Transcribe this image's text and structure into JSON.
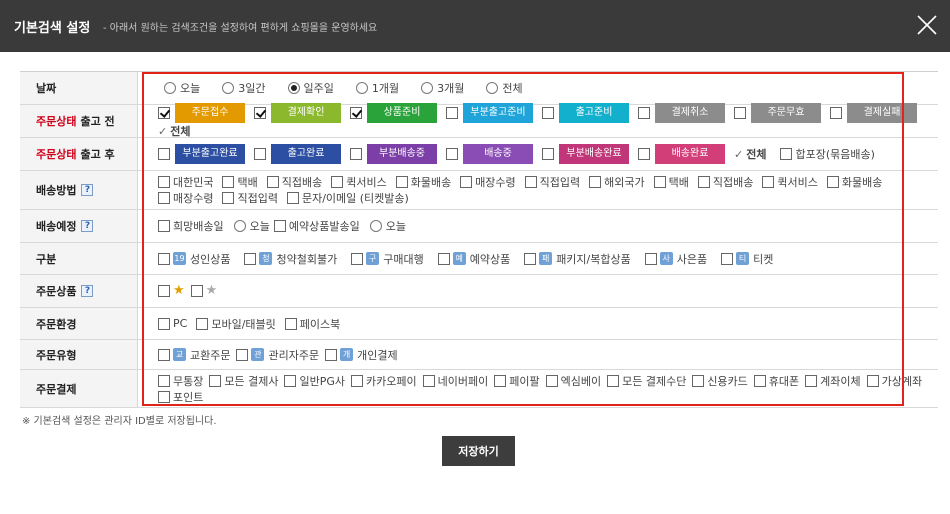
{
  "header": {
    "title": "기본검색 설정",
    "subtitle": "- 아래서 원하는 검색조건을 설정하여 편하게 쇼핑몰을 운영하세요"
  },
  "rows": {
    "date": {
      "label": "날짜",
      "options": [
        {
          "label": "오늘",
          "selected": false
        },
        {
          "label": "3일간",
          "selected": false
        },
        {
          "label": "일주일",
          "selected": true
        },
        {
          "label": "1개월",
          "selected": false
        },
        {
          "label": "3개월",
          "selected": false
        },
        {
          "label": "전체",
          "selected": false
        }
      ]
    },
    "status_before": {
      "label_red": "주문상태",
      "label_sub": "출고 전",
      "chips": [
        {
          "label": "주문접수",
          "checked": true,
          "color": "#e39a00"
        },
        {
          "label": "결제확인",
          "checked": true,
          "color": "#8cb82e"
        },
        {
          "label": "상품준비",
          "checked": true,
          "color": "#2aa33a"
        },
        {
          "label": "부분출고준비",
          "checked": false,
          "color": "#1ea4d8"
        },
        {
          "label": "출고준비",
          "checked": false,
          "color": "#12b0cc"
        },
        {
          "label": "결제취소",
          "checked": false,
          "color": "#8c8c8c"
        },
        {
          "label": "주문무효",
          "checked": false,
          "color": "#8c8c8c"
        },
        {
          "label": "결제실패",
          "checked": false,
          "color": "#8c8c8c"
        }
      ],
      "all_label": "전체"
    },
    "status_after": {
      "label_red": "주문상태",
      "label_sub": "출고 후",
      "chips": [
        {
          "label": "부분출고완료",
          "checked": false,
          "color": "#2d4fa3"
        },
        {
          "label": "출고완료",
          "checked": false,
          "color": "#2d4fa3"
        },
        {
          "label": "부분배송중",
          "checked": false,
          "color": "#7c3fa8"
        },
        {
          "label": "배송중",
          "checked": false,
          "color": "#8a4cb5"
        },
        {
          "label": "부분배송완료",
          "checked": false,
          "color": "#c03678"
        },
        {
          "label": "배송완료",
          "checked": false,
          "color": "#d23f78"
        }
      ],
      "all_label": "전체",
      "extra": "합포장(묶음배송)"
    },
    "shipping_method": {
      "label": "배송방법",
      "help": "?",
      "items": [
        "대한민국",
        "택배",
        "직접배송",
        "퀵서비스",
        "화물배송",
        "매장수령",
        "직접입력",
        "해외국가",
        "택배",
        "직접배송",
        "퀵서비스",
        "화물배송",
        "매장수령",
        "직접입력",
        "문자/이메일 (티켓발송)"
      ]
    },
    "shipping_schedule": {
      "label": "배송예정",
      "help": "?",
      "items": [
        {
          "type": "check",
          "label": "희망배송일"
        },
        {
          "type": "radio",
          "label": "오늘"
        },
        {
          "type": "check",
          "label": "예약상품발송일"
        },
        {
          "type": "radio",
          "label": "오늘"
        }
      ]
    },
    "category": {
      "label": "구분",
      "items": [
        {
          "mark": "19",
          "label": "성인상품"
        },
        {
          "mark": "청",
          "label": "청약철회불가"
        },
        {
          "mark": "구",
          "label": "구매대행"
        },
        {
          "mark": "예",
          "label": "예약상품"
        },
        {
          "mark": "패",
          "label": "패키지/복합상품"
        },
        {
          "mark": "사",
          "label": "사은품"
        },
        {
          "mark": "티",
          "label": "티켓"
        }
      ]
    },
    "order_product": {
      "label": "주문상품",
      "help": "?",
      "items": [
        {
          "star_color": "#e0a000"
        },
        {
          "star_color": "#aaaaaa"
        }
      ]
    },
    "order_env": {
      "label": "주문환경",
      "items": [
        "PC",
        "모바일/태블릿",
        "페이스북"
      ]
    },
    "order_type": {
      "label": "주문유형",
      "items": [
        {
          "mark": "교",
          "label": "교환주문"
        },
        {
          "mark": "관",
          "label": "관리자주문"
        },
        {
          "mark": "개",
          "label": "개인결제"
        }
      ]
    },
    "payment": {
      "label": "주문결제",
      "items": [
        "무통장",
        "모든 결제사",
        "일반PG사",
        "카카오페이",
        "네이버페이",
        "페이팔",
        "엑심베이",
        "모든 결제수단",
        "신용카드",
        "휴대폰",
        "계좌이체",
        "가상계좌",
        "포인트"
      ]
    }
  },
  "footer": {
    "note": "※ 기본검색 설정은 관리자 ID별로 저장됩니다.",
    "save_label": "저장하기"
  }
}
